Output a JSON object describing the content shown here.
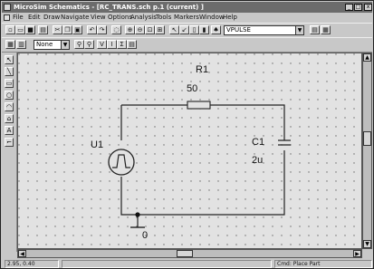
{
  "window": {
    "title": "MicroSim Schematics - [RC_TRANS.sch p.1 (current) ]",
    "minimize_glyph": "_",
    "maximize_glyph": "□",
    "close_glyph": "x"
  },
  "menubar": {
    "items": [
      "File",
      "Edit",
      "Draw",
      "Navigate",
      "View",
      "Options",
      "Analysis",
      "Tools",
      "Markers",
      "Window",
      "Help"
    ]
  },
  "toolbar": {
    "part_combo_value": "VPULSE",
    "attr_combo_value": "None"
  },
  "schematic": {
    "resistor": {
      "ref": "R1",
      "value": "50"
    },
    "capacitor": {
      "ref": "C1",
      "value": "2u"
    },
    "source": {
      "ref": "U1"
    },
    "ground": {
      "label": "0"
    }
  },
  "status": {
    "coordinates": "2.95, 0.40",
    "command": "Cmd: Place Part"
  },
  "icons": {
    "left_tools": [
      "select-icon",
      "line-icon",
      "rectangle-icon",
      "circle-icon",
      "arc-icon",
      "polyline-icon",
      "text-icon",
      "wire-icon"
    ]
  }
}
